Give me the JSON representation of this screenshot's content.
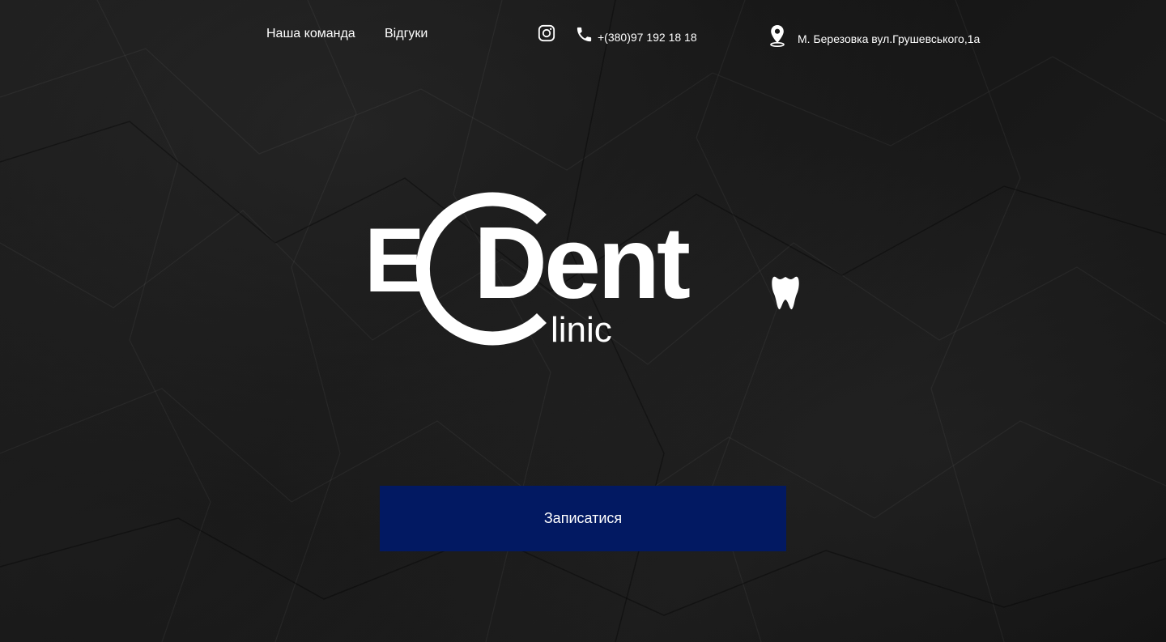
{
  "nav": {
    "team_label": "Наша команда",
    "reviews_label": "Відгуки"
  },
  "contacts": {
    "instagram_icon": "instagram-icon",
    "phone_icon": "phone-icon",
    "phone": "+(380)97 192 18 18",
    "location_icon": "map-pin-icon",
    "address": "М. Березовка вул.Грушевського,1а"
  },
  "logo": {
    "text_e": "E",
    "text_c": "C",
    "text_dent": "Dent",
    "text_linic": "linic",
    "tooth_icon": "tooth-icon"
  },
  "cta": {
    "label": "Записатися"
  },
  "colors": {
    "background": "#161616",
    "text": "#ffffff",
    "button": "#021962"
  }
}
